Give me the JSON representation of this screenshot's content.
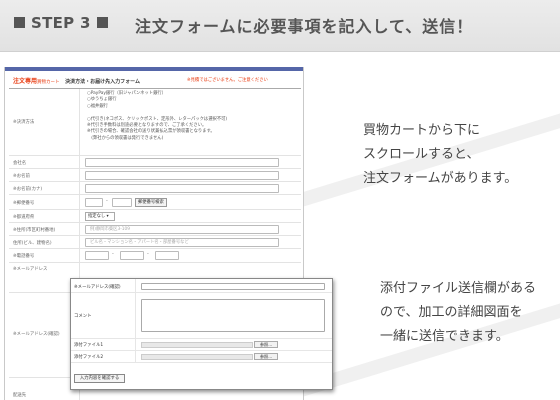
{
  "header": {
    "step": "STEP 3",
    "title": "注文フォームに必要事項を記入して、送信！"
  },
  "form": {
    "heading": "注文専用",
    "heading_small": "買物カート",
    "subheading": "決済方法・お届け先入力フォーム",
    "required_note": "※見積ではございません。ご注意ください",
    "payment_label": "※決済方法",
    "payment_options": [
      "○PayPay銀行（旧ジャパンネット銀行）",
      "○ゆうちょ銀行",
      "○福井銀行",
      "",
      "○代引き(ネコポス、クリックポスト、定形外、レターパックは選択不可)",
      "※代引き手数料は別途必要となりますので、ご了承ください。",
      "※代引きの場合、確認会社の送り状兼払込票が領収書となります。",
      "　(弊社からの領収書は発行できません)"
    ],
    "fields": [
      {
        "label": "会社名"
      },
      {
        "label": "※お名前"
      },
      {
        "label": "※お名前(カナ)"
      },
      {
        "label": "※郵便番号",
        "button": "郵便番号検索"
      },
      {
        "label": "※都道府県",
        "select": "指定なし ▾"
      },
      {
        "label": "※住所(市区町村番地)",
        "placeholder": "例)静岡市葵区3-109"
      },
      {
        "label": "住所(ビル、建物名)",
        "placeholder": "ビル名・マンション名・アパート名・部屋番号など"
      },
      {
        "label": "※電話番号"
      },
      {
        "label": "※メールアドレス"
      },
      {
        "label": "※メールアドレス(確認)"
      },
      {
        "label": "配送先"
      }
    ]
  },
  "zoom": {
    "email_confirm_label": "※メールアドレス(確認)",
    "comment_label": "コメント",
    "file1_label": "添付ファイル1",
    "file2_label": "添付ファイル2",
    "browse_label": "参照...",
    "confirm_button": "入力内容を確認する"
  },
  "callouts": {
    "top": [
      "買物カートから下に",
      "スクロールすると、",
      "注文フォームがあります。"
    ],
    "bottom": [
      "添付ファイル送信欄がある",
      "ので、加工の詳細図面を",
      "一緒に送信できます。"
    ]
  }
}
